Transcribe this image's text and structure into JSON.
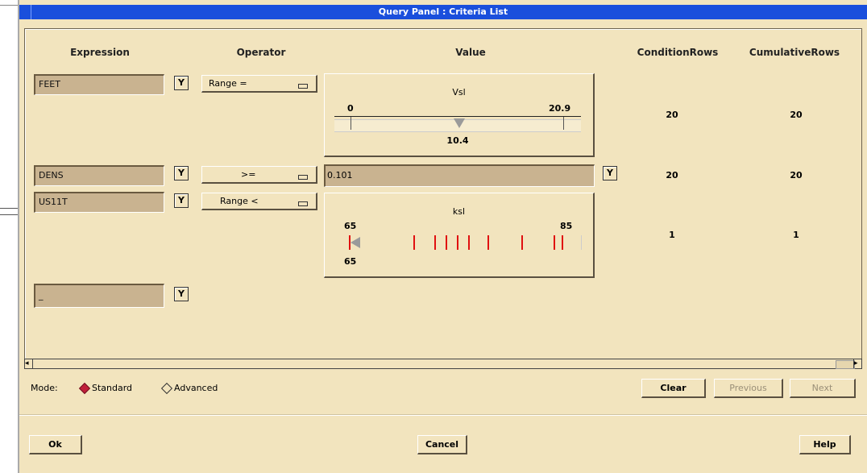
{
  "window": {
    "title": "Query Panel : Criteria List"
  },
  "columns": {
    "expression": "Expression",
    "operator": "Operator",
    "value": "Value",
    "condition_rows": "ConditionRows",
    "cumulative_rows": "CumulativeRows"
  },
  "rows": [
    {
      "expression": "FEET",
      "operator": "Range =",
      "value_type": "slider",
      "slider_title": "Vsl",
      "min_label": "0",
      "max_label": "20.9",
      "current": "10.4",
      "current_fraction": 0.5,
      "condition_rows": "20",
      "cumulative_rows": "20"
    },
    {
      "expression": "DENS",
      "operator": ">=",
      "value_type": "text",
      "value": "0.101",
      "condition_rows": "20",
      "cumulative_rows": "20"
    },
    {
      "expression": "US11T",
      "operator": "Range <",
      "value_type": "ticks",
      "slider_title": "ksl",
      "min_label": "65",
      "max_label": "85",
      "current": "65",
      "current_fraction": 0.0,
      "tick_color": "#e01010",
      "condition_rows": "1",
      "cumulative_rows": "1"
    },
    {
      "expression": "_"
    }
  ],
  "dropdown_glyph": "Y",
  "mode": {
    "label": "Mode:",
    "options": [
      "Standard",
      "Advanced"
    ],
    "selected": "Standard"
  },
  "buttons": {
    "clear": "Clear",
    "previous": "Previous",
    "next": "Next",
    "ok": "Ok",
    "cancel": "Cancel",
    "help": "Help"
  },
  "colors": {
    "panel_bg": "#f2e4be",
    "field_bg": "#c9b390",
    "titlebar": "#1a4fdc",
    "tick_red": "#e01010",
    "radio_selected": "#c0203a"
  }
}
